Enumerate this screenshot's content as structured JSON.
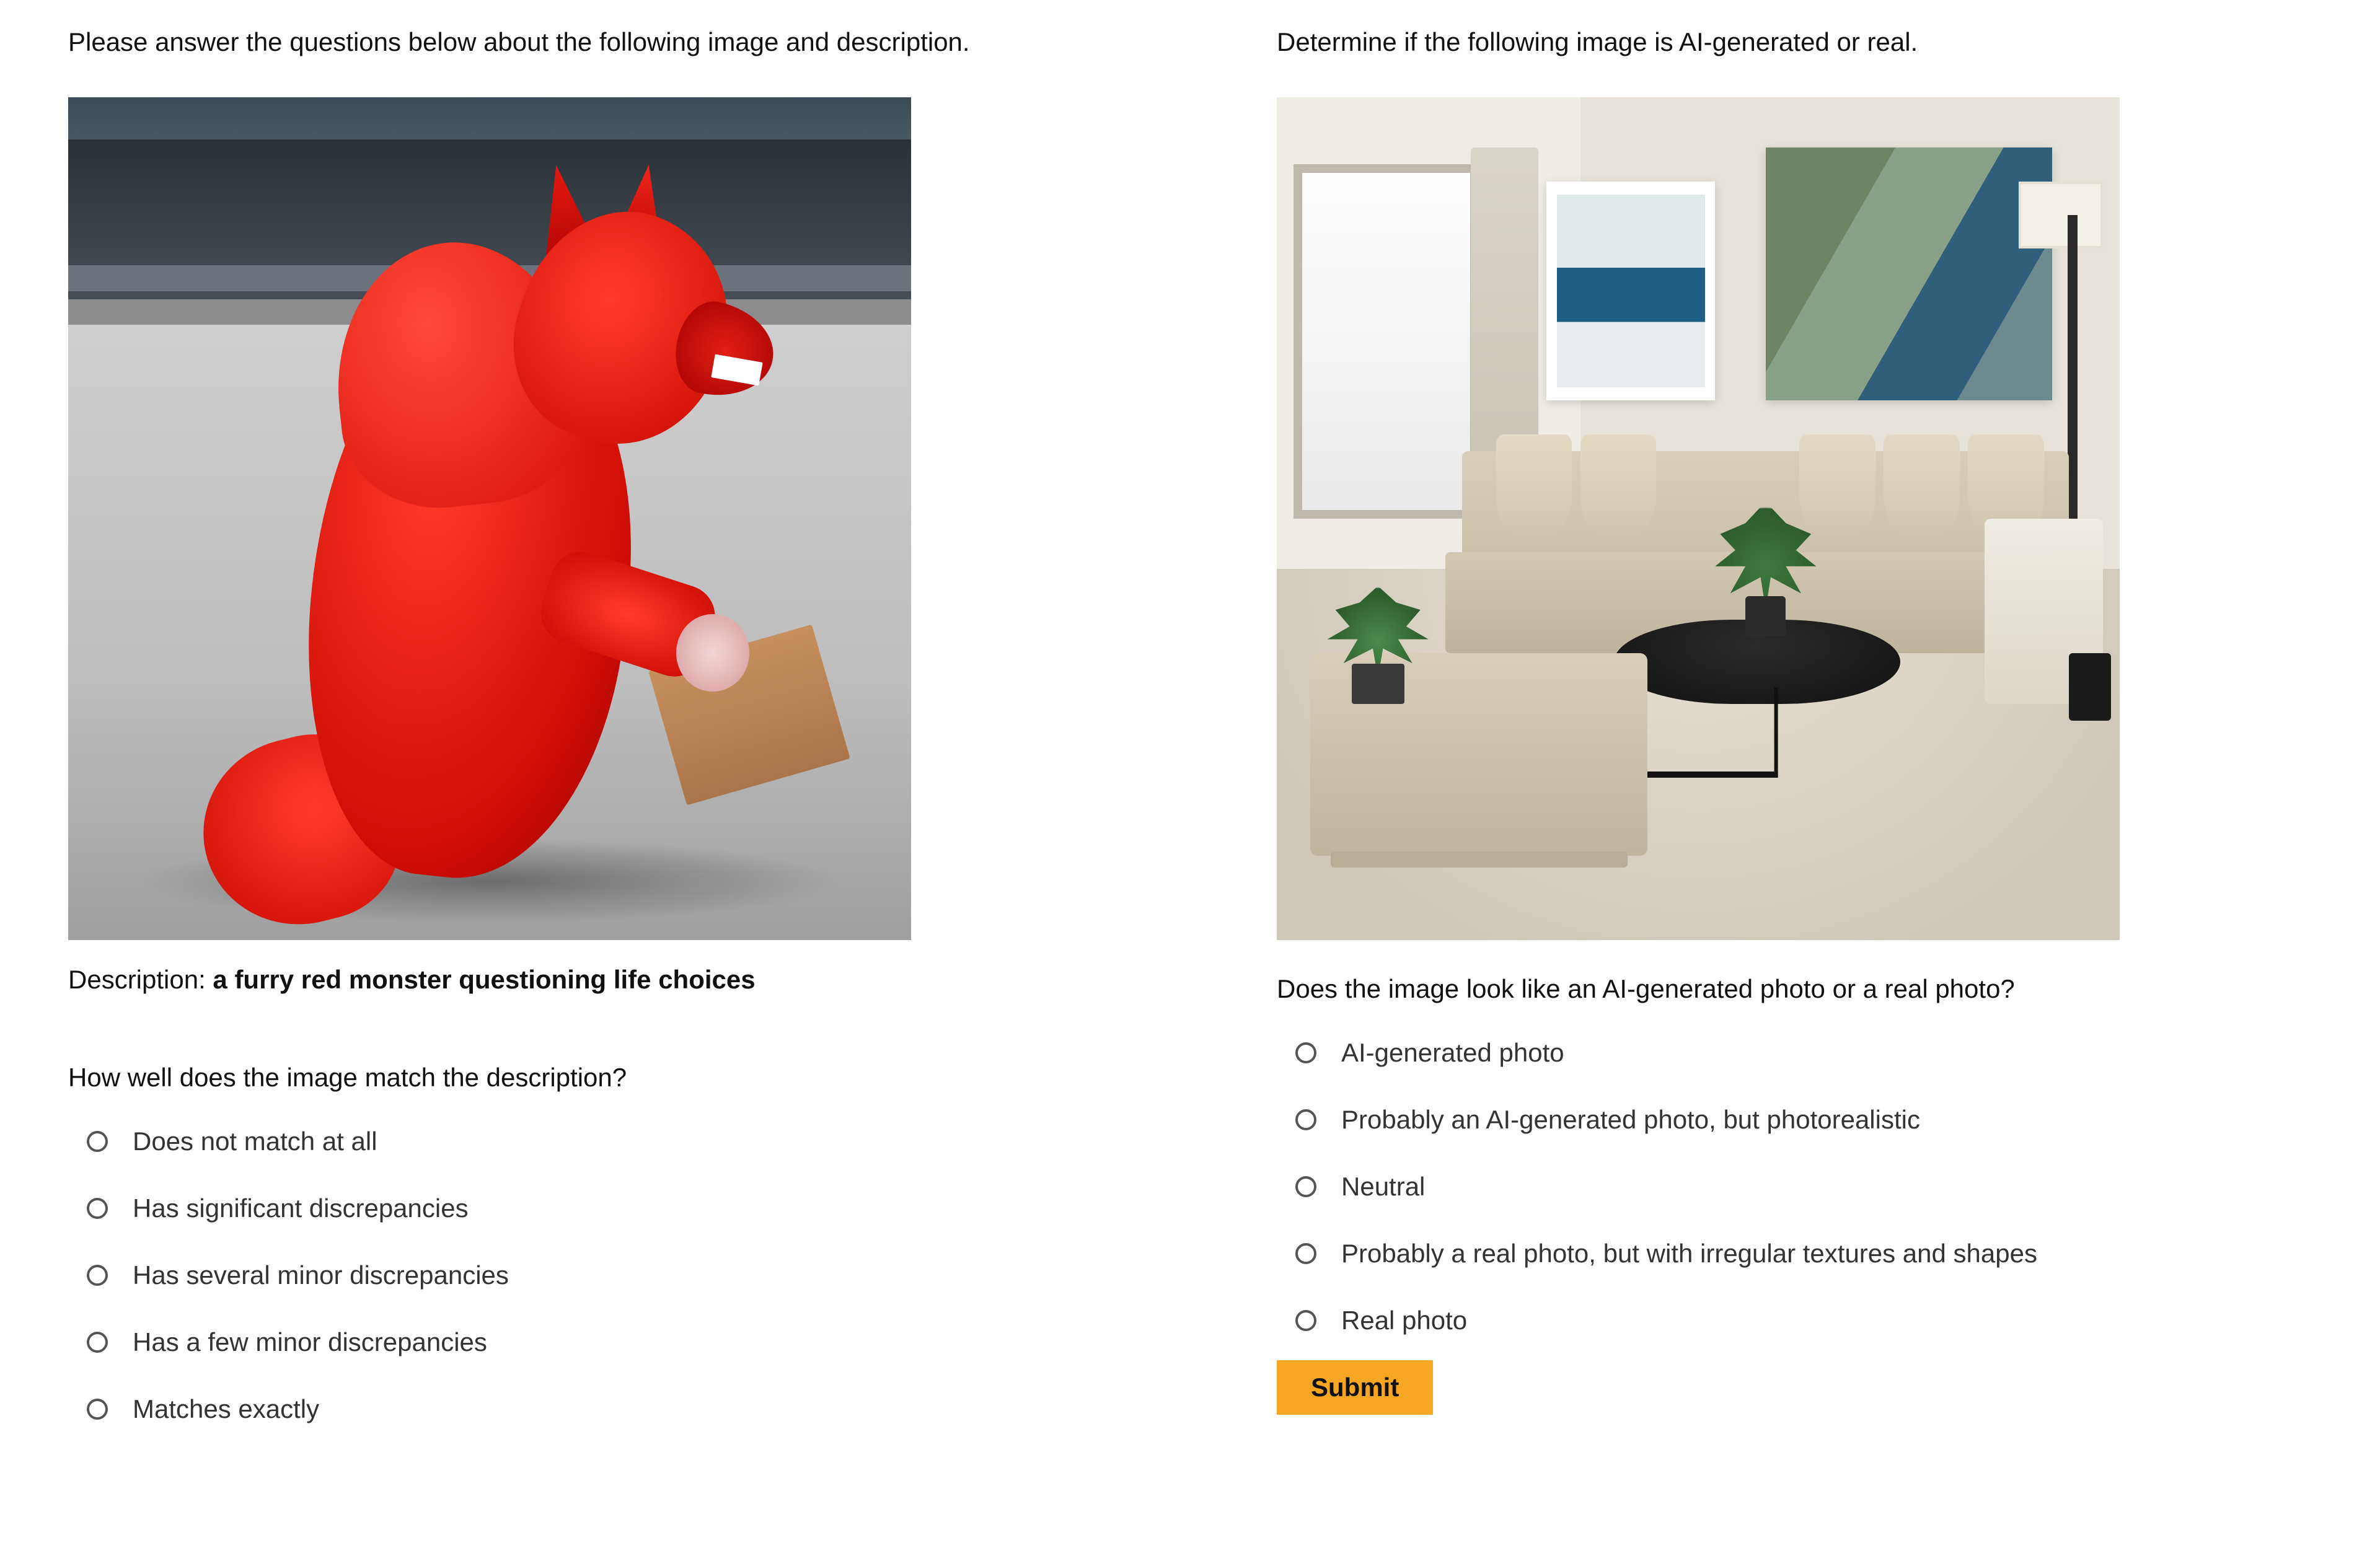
{
  "left": {
    "instruction": "Please answer the questions below about the following image and description.",
    "description_label": "Description: ",
    "description_text": "a furry red monster questioning life choices",
    "question": "How well does the image match the description?",
    "options": [
      "Does not match at all",
      "Has significant discrepancies",
      "Has several minor discrepancies",
      "Has a few minor discrepancies",
      "Matches exactly"
    ]
  },
  "right": {
    "instruction": "Determine if the following image is AI-generated or real.",
    "question": "Does the image look like an AI-generated photo or a real photo?",
    "options": [
      "AI-generated photo",
      "Probably an AI-generated photo, but photorealistic",
      "Neutral",
      "Probably a real photo, but with irregular textures and shapes",
      "Real photo"
    ],
    "submit_label": "Submit"
  }
}
